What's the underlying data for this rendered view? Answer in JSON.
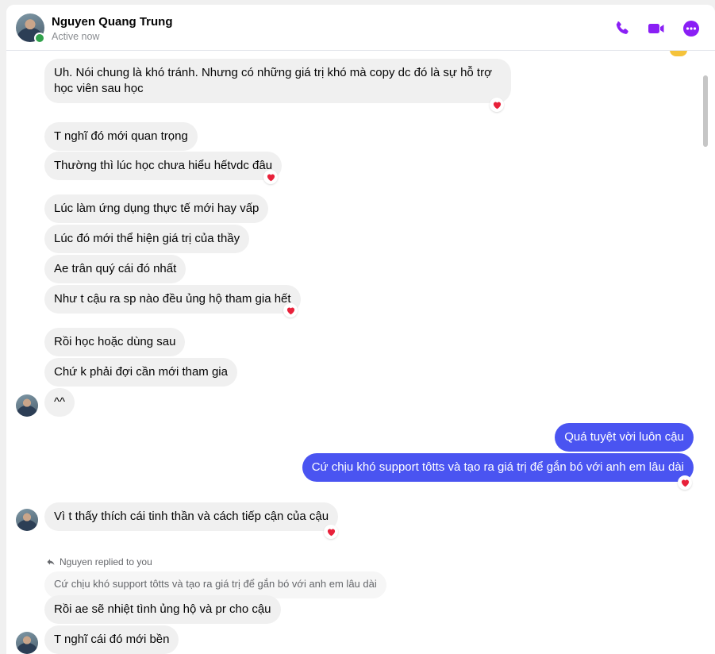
{
  "header": {
    "name": "Nguyen Quang Trung",
    "status": "Active now",
    "accent_color": "#8a1ff5",
    "icons": [
      "phone-icon",
      "video-camera-icon",
      "more-options-icon"
    ]
  },
  "messages": {
    "m1": "Uh. Nói chung là khó tránh. Nhưng có những giá trị khó mà copy dc đó là sự hỗ trợ học viên sau học",
    "m2": "T nghĩ đó mới quan trọng",
    "m3": "Thường thì lúc học chưa hiểu hếtvdc đâu",
    "m4": "Lúc làm ứng dụng thực tế mới hay vấp",
    "m5": "Lúc đó mới thể hiện giá trị của thầy",
    "m6": "Ae trân quý cái đó nhất",
    "m7": "Như t cậu ra sp nào đều ủng hộ tham gia hết",
    "m8": "Rồi học hoặc dùng sau",
    "m9": "Chứ k phải đợi cần mới tham gia",
    "m10": "^^",
    "m11": "Quá tuyệt vời luôn cậu",
    "m12": "Cứ chịu khó support tôtts và tạo ra giá trị để gắn bó với anh em lâu dài",
    "m13": "Vì t thấy thích cái tinh thần và cách tiếp cận của cậu",
    "reply_note": "Nguyen replied to you",
    "quoted": "Cứ chịu khó support tôtts và tạo ra giá trị để gắn bó với anh em lâu dài",
    "m14": "Rồi ae sẽ nhiệt tình ủng hộ và pr cho cậu",
    "m15": "T nghĩ cái đó mới bền"
  },
  "colors": {
    "my_bubble": "#4a54f1",
    "their_bubble": "#f0f0f0",
    "reaction": "#e8213a"
  },
  "reactions": [
    "m1",
    "m3",
    "m7",
    "m12",
    "m13"
  ]
}
